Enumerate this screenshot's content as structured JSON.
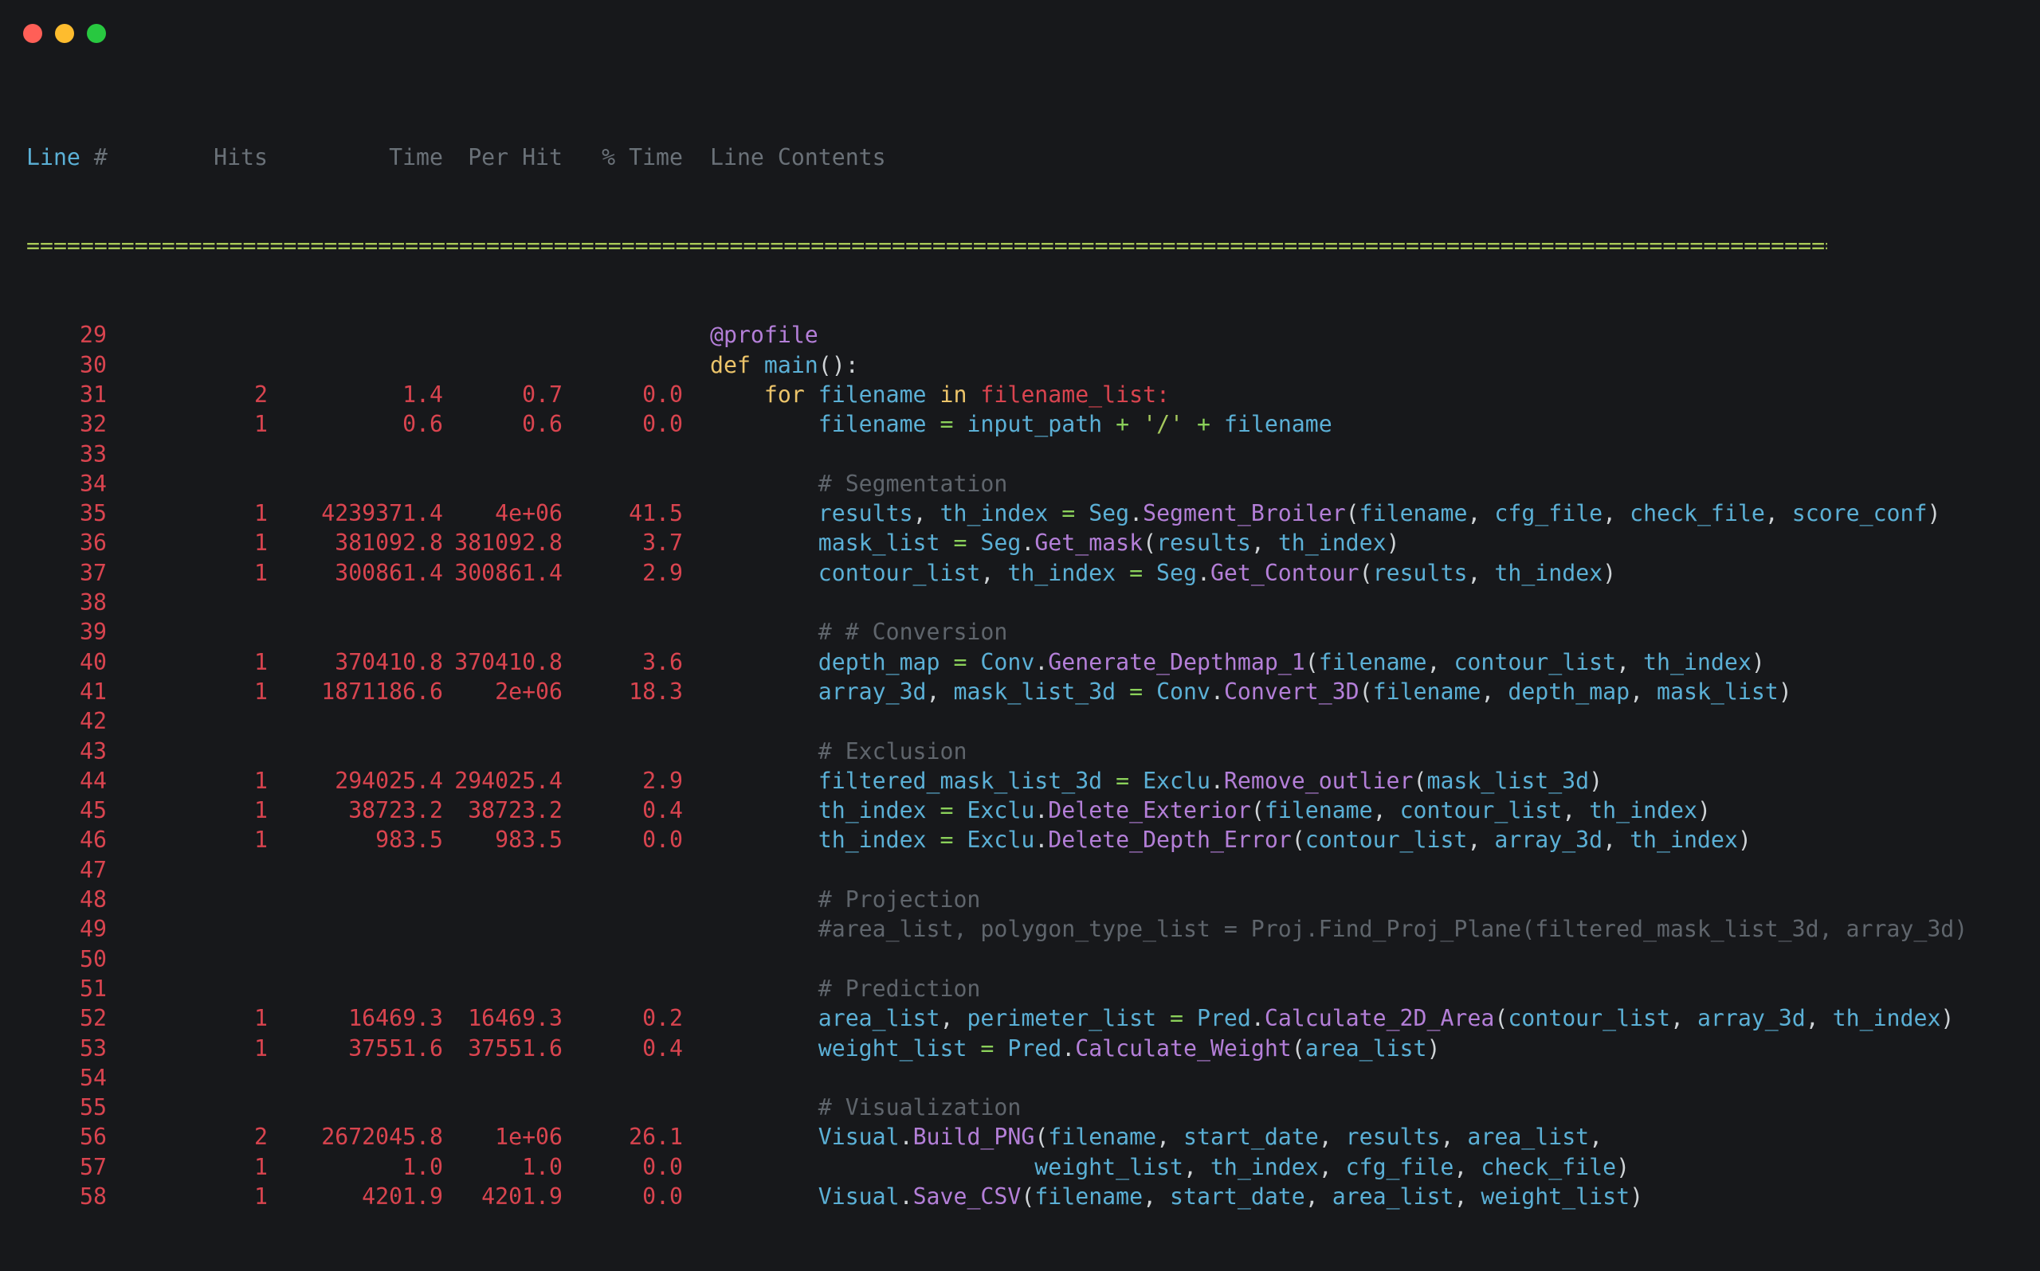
{
  "window": {
    "controls": [
      "close",
      "minimize",
      "maximize"
    ]
  },
  "header": {
    "line_word": "Line",
    "hash": "#",
    "hits": "Hits",
    "time": "Time",
    "per_hit": "Per Hit",
    "pct_time": "% Time",
    "contents": "Line Contents"
  },
  "separator": "==============================================================================================================================================",
  "rows": [
    {
      "line": "29",
      "hits": "",
      "time": "",
      "per_hit": "",
      "pct": "",
      "code": [
        {
          "t": "@profile",
          "c": "deco"
        }
      ]
    },
    {
      "line": "30",
      "hits": "",
      "time": "",
      "per_hit": "",
      "pct": "",
      "code": [
        {
          "t": "def ",
          "c": "kw"
        },
        {
          "t": "main",
          "c": "fn"
        },
        {
          "t": "():",
          "c": "punc"
        }
      ]
    },
    {
      "line": "31",
      "hits": "2",
      "time": "1.4",
      "per_hit": "0.7",
      "pct": "0.0",
      "code": [
        {
          "t": "    for ",
          "c": "kw"
        },
        {
          "t": "filename ",
          "c": "id"
        },
        {
          "t": "in ",
          "c": "kw"
        },
        {
          "t": "filename_list:",
          "c": "red"
        }
      ]
    },
    {
      "line": "32",
      "hits": "1",
      "time": "0.6",
      "per_hit": "0.6",
      "pct": "0.0",
      "code": [
        {
          "t": "        filename ",
          "c": "id"
        },
        {
          "t": "= ",
          "c": "op"
        },
        {
          "t": "input_path ",
          "c": "id"
        },
        {
          "t": "+ ",
          "c": "op"
        },
        {
          "t": "'/' ",
          "c": "str"
        },
        {
          "t": "+ ",
          "c": "op"
        },
        {
          "t": "filename",
          "c": "id"
        }
      ]
    },
    {
      "line": "33",
      "hits": "",
      "time": "",
      "per_hit": "",
      "pct": "",
      "code": []
    },
    {
      "line": "34",
      "hits": "",
      "time": "",
      "per_hit": "",
      "pct": "",
      "code": [
        {
          "t": "        # Segmentation",
          "c": "cmt"
        }
      ]
    },
    {
      "line": "35",
      "hits": "1",
      "time": "4239371.4",
      "per_hit": "4e+06",
      "pct": "41.5",
      "code": [
        {
          "t": "        results",
          "c": "id"
        },
        {
          "t": ", ",
          "c": "punc"
        },
        {
          "t": "th_index ",
          "c": "id"
        },
        {
          "t": "= ",
          "c": "op"
        },
        {
          "t": "Seg",
          "c": "id"
        },
        {
          "t": ".",
          "c": "punc"
        },
        {
          "t": "Segment_Broiler",
          "c": "meth"
        },
        {
          "t": "(",
          "c": "punc"
        },
        {
          "t": "filename",
          "c": "id"
        },
        {
          "t": ", ",
          "c": "punc"
        },
        {
          "t": "cfg_file",
          "c": "id"
        },
        {
          "t": ", ",
          "c": "punc"
        },
        {
          "t": "check_file",
          "c": "id"
        },
        {
          "t": ", ",
          "c": "punc"
        },
        {
          "t": "score_conf",
          "c": "id"
        },
        {
          "t": ")",
          "c": "punc"
        }
      ]
    },
    {
      "line": "36",
      "hits": "1",
      "time": "381092.8",
      "per_hit": "381092.8",
      "pct": "3.7",
      "code": [
        {
          "t": "        mask_list ",
          "c": "id"
        },
        {
          "t": "= ",
          "c": "op"
        },
        {
          "t": "Seg",
          "c": "id"
        },
        {
          "t": ".",
          "c": "punc"
        },
        {
          "t": "Get_mask",
          "c": "meth"
        },
        {
          "t": "(",
          "c": "punc"
        },
        {
          "t": "results",
          "c": "id"
        },
        {
          "t": ", ",
          "c": "punc"
        },
        {
          "t": "th_index",
          "c": "id"
        },
        {
          "t": ")",
          "c": "punc"
        }
      ]
    },
    {
      "line": "37",
      "hits": "1",
      "time": "300861.4",
      "per_hit": "300861.4",
      "pct": "2.9",
      "code": [
        {
          "t": "        contour_list",
          "c": "id"
        },
        {
          "t": ", ",
          "c": "punc"
        },
        {
          "t": "th_index ",
          "c": "id"
        },
        {
          "t": "= ",
          "c": "op"
        },
        {
          "t": "Seg",
          "c": "id"
        },
        {
          "t": ".",
          "c": "punc"
        },
        {
          "t": "Get_Contour",
          "c": "meth"
        },
        {
          "t": "(",
          "c": "punc"
        },
        {
          "t": "results",
          "c": "id"
        },
        {
          "t": ", ",
          "c": "punc"
        },
        {
          "t": "th_index",
          "c": "id"
        },
        {
          "t": ")",
          "c": "punc"
        }
      ]
    },
    {
      "line": "38",
      "hits": "",
      "time": "",
      "per_hit": "",
      "pct": "",
      "code": []
    },
    {
      "line": "39",
      "hits": "",
      "time": "",
      "per_hit": "",
      "pct": "",
      "code": [
        {
          "t": "        # # Conversion",
          "c": "cmt"
        }
      ]
    },
    {
      "line": "40",
      "hits": "1",
      "time": "370410.8",
      "per_hit": "370410.8",
      "pct": "3.6",
      "code": [
        {
          "t": "        depth_map ",
          "c": "id"
        },
        {
          "t": "= ",
          "c": "op"
        },
        {
          "t": "Conv",
          "c": "id"
        },
        {
          "t": ".",
          "c": "punc"
        },
        {
          "t": "Generate_Depthmap_1",
          "c": "meth"
        },
        {
          "t": "(",
          "c": "punc"
        },
        {
          "t": "filename",
          "c": "id"
        },
        {
          "t": ", ",
          "c": "punc"
        },
        {
          "t": "contour_list",
          "c": "id"
        },
        {
          "t": ", ",
          "c": "punc"
        },
        {
          "t": "th_index",
          "c": "id"
        },
        {
          "t": ")",
          "c": "punc"
        }
      ]
    },
    {
      "line": "41",
      "hits": "1",
      "time": "1871186.6",
      "per_hit": "2e+06",
      "pct": "18.3",
      "code": [
        {
          "t": "        array_3d",
          "c": "id"
        },
        {
          "t": ", ",
          "c": "punc"
        },
        {
          "t": "mask_list_3d ",
          "c": "id"
        },
        {
          "t": "= ",
          "c": "op"
        },
        {
          "t": "Conv",
          "c": "id"
        },
        {
          "t": ".",
          "c": "punc"
        },
        {
          "t": "Convert_3D",
          "c": "meth"
        },
        {
          "t": "(",
          "c": "punc"
        },
        {
          "t": "filename",
          "c": "id"
        },
        {
          "t": ", ",
          "c": "punc"
        },
        {
          "t": "depth_map",
          "c": "id"
        },
        {
          "t": ", ",
          "c": "punc"
        },
        {
          "t": "mask_list",
          "c": "id"
        },
        {
          "t": ")",
          "c": "punc"
        }
      ]
    },
    {
      "line": "42",
      "hits": "",
      "time": "",
      "per_hit": "",
      "pct": "",
      "code": []
    },
    {
      "line": "43",
      "hits": "",
      "time": "",
      "per_hit": "",
      "pct": "",
      "code": [
        {
          "t": "        # Exclusion",
          "c": "cmt"
        }
      ]
    },
    {
      "line": "44",
      "hits": "1",
      "time": "294025.4",
      "per_hit": "294025.4",
      "pct": "2.9",
      "code": [
        {
          "t": "        filtered_mask_list_3d ",
          "c": "id"
        },
        {
          "t": "= ",
          "c": "op"
        },
        {
          "t": "Exclu",
          "c": "id"
        },
        {
          "t": ".",
          "c": "punc"
        },
        {
          "t": "Remove_outlier",
          "c": "meth"
        },
        {
          "t": "(",
          "c": "punc"
        },
        {
          "t": "mask_list_3d",
          "c": "id"
        },
        {
          "t": ")",
          "c": "punc"
        }
      ]
    },
    {
      "line": "45",
      "hits": "1",
      "time": "38723.2",
      "per_hit": "38723.2",
      "pct": "0.4",
      "code": [
        {
          "t": "        th_index ",
          "c": "id"
        },
        {
          "t": "= ",
          "c": "op"
        },
        {
          "t": "Exclu",
          "c": "id"
        },
        {
          "t": ".",
          "c": "punc"
        },
        {
          "t": "Delete_Exterior",
          "c": "meth"
        },
        {
          "t": "(",
          "c": "punc"
        },
        {
          "t": "filename",
          "c": "id"
        },
        {
          "t": ", ",
          "c": "punc"
        },
        {
          "t": "contour_list",
          "c": "id"
        },
        {
          "t": ", ",
          "c": "punc"
        },
        {
          "t": "th_index",
          "c": "id"
        },
        {
          "t": ")",
          "c": "punc"
        }
      ]
    },
    {
      "line": "46",
      "hits": "1",
      "time": "983.5",
      "per_hit": "983.5",
      "pct": "0.0",
      "code": [
        {
          "t": "        th_index ",
          "c": "id"
        },
        {
          "t": "= ",
          "c": "op"
        },
        {
          "t": "Exclu",
          "c": "id"
        },
        {
          "t": ".",
          "c": "punc"
        },
        {
          "t": "Delete_Depth_Error",
          "c": "meth"
        },
        {
          "t": "(",
          "c": "punc"
        },
        {
          "t": "contour_list",
          "c": "id"
        },
        {
          "t": ", ",
          "c": "punc"
        },
        {
          "t": "array_3d",
          "c": "id"
        },
        {
          "t": ", ",
          "c": "punc"
        },
        {
          "t": "th_index",
          "c": "id"
        },
        {
          "t": ")",
          "c": "punc"
        }
      ]
    },
    {
      "line": "47",
      "hits": "",
      "time": "",
      "per_hit": "",
      "pct": "",
      "code": []
    },
    {
      "line": "48",
      "hits": "",
      "time": "",
      "per_hit": "",
      "pct": "",
      "code": [
        {
          "t": "        # Projection",
          "c": "cmt"
        }
      ]
    },
    {
      "line": "49",
      "hits": "",
      "time": "",
      "per_hit": "",
      "pct": "",
      "code": [
        {
          "t": "        #area_list, polygon_type_list = Proj.Find_Proj_Plane(filtered_mask_list_3d, array_3d)",
          "c": "cmt"
        }
      ]
    },
    {
      "line": "50",
      "hits": "",
      "time": "",
      "per_hit": "",
      "pct": "",
      "code": []
    },
    {
      "line": "51",
      "hits": "",
      "time": "",
      "per_hit": "",
      "pct": "",
      "code": [
        {
          "t": "        # Prediction",
          "c": "cmt"
        }
      ]
    },
    {
      "line": "52",
      "hits": "1",
      "time": "16469.3",
      "per_hit": "16469.3",
      "pct": "0.2",
      "code": [
        {
          "t": "        area_list",
          "c": "id"
        },
        {
          "t": ", ",
          "c": "punc"
        },
        {
          "t": "perimeter_list ",
          "c": "id"
        },
        {
          "t": "= ",
          "c": "op"
        },
        {
          "t": "Pred",
          "c": "id"
        },
        {
          "t": ".",
          "c": "punc"
        },
        {
          "t": "Calculate_2D_Area",
          "c": "meth"
        },
        {
          "t": "(",
          "c": "punc"
        },
        {
          "t": "contour_list",
          "c": "id"
        },
        {
          "t": ", ",
          "c": "punc"
        },
        {
          "t": "array_3d",
          "c": "id"
        },
        {
          "t": ", ",
          "c": "punc"
        },
        {
          "t": "th_index",
          "c": "id"
        },
        {
          "t": ")",
          "c": "punc"
        }
      ]
    },
    {
      "line": "53",
      "hits": "1",
      "time": "37551.6",
      "per_hit": "37551.6",
      "pct": "0.4",
      "code": [
        {
          "t": "        weight_list ",
          "c": "id"
        },
        {
          "t": "= ",
          "c": "op"
        },
        {
          "t": "Pred",
          "c": "id"
        },
        {
          "t": ".",
          "c": "punc"
        },
        {
          "t": "Calculate_Weight",
          "c": "meth"
        },
        {
          "t": "(",
          "c": "punc"
        },
        {
          "t": "area_list",
          "c": "id"
        },
        {
          "t": ")",
          "c": "punc"
        }
      ]
    },
    {
      "line": "54",
      "hits": "",
      "time": "",
      "per_hit": "",
      "pct": "",
      "code": []
    },
    {
      "line": "55",
      "hits": "",
      "time": "",
      "per_hit": "",
      "pct": "",
      "code": [
        {
          "t": "        # Visualization",
          "c": "cmt"
        }
      ]
    },
    {
      "line": "56",
      "hits": "2",
      "time": "2672045.8",
      "per_hit": "1e+06",
      "pct": "26.1",
      "code": [
        {
          "t": "        Visual",
          "c": "id"
        },
        {
          "t": ".",
          "c": "punc"
        },
        {
          "t": "Build_PNG",
          "c": "meth"
        },
        {
          "t": "(",
          "c": "punc"
        },
        {
          "t": "filename",
          "c": "id"
        },
        {
          "t": ", ",
          "c": "punc"
        },
        {
          "t": "start_date",
          "c": "id"
        },
        {
          "t": ", ",
          "c": "punc"
        },
        {
          "t": "results",
          "c": "id"
        },
        {
          "t": ", ",
          "c": "punc"
        },
        {
          "t": "area_list",
          "c": "id"
        },
        {
          "t": ",",
          "c": "punc"
        }
      ]
    },
    {
      "line": "57",
      "hits": "1",
      "time": "1.0",
      "per_hit": "1.0",
      "pct": "0.0",
      "code": [
        {
          "t": "                        weight_list",
          "c": "id"
        },
        {
          "t": ", ",
          "c": "punc"
        },
        {
          "t": "th_index",
          "c": "id"
        },
        {
          "t": ", ",
          "c": "punc"
        },
        {
          "t": "cfg_file",
          "c": "id"
        },
        {
          "t": ", ",
          "c": "punc"
        },
        {
          "t": "check_file",
          "c": "id"
        },
        {
          "t": ")",
          "c": "punc"
        }
      ]
    },
    {
      "line": "58",
      "hits": "1",
      "time": "4201.9",
      "per_hit": "4201.9",
      "pct": "0.0",
      "code": [
        {
          "t": "        Visual",
          "c": "id"
        },
        {
          "t": ".",
          "c": "punc"
        },
        {
          "t": "Save_CSV",
          "c": "meth"
        },
        {
          "t": "(",
          "c": "punc"
        },
        {
          "t": "filename",
          "c": "id"
        },
        {
          "t": ", ",
          "c": "punc"
        },
        {
          "t": "start_date",
          "c": "id"
        },
        {
          "t": ", ",
          "c": "punc"
        },
        {
          "t": "area_list",
          "c": "id"
        },
        {
          "t": ", ",
          "c": "punc"
        },
        {
          "t": "weight_list",
          "c": "id"
        },
        {
          "t": ")",
          "c": "punc"
        }
      ]
    }
  ]
}
